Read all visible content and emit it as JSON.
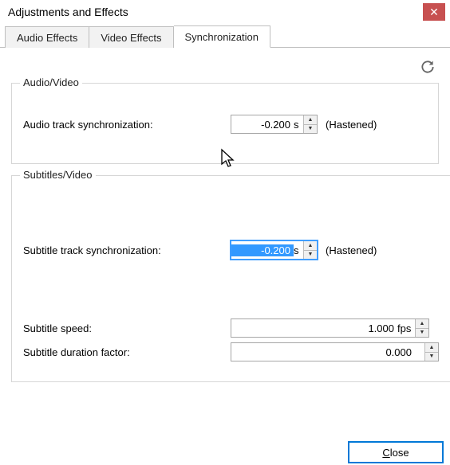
{
  "window": {
    "title": "Adjustments and Effects"
  },
  "tabs": {
    "audio": "Audio Effects",
    "video": "Video Effects",
    "sync": "Synchronization"
  },
  "groups": {
    "av": "Audio/Video",
    "sub": "Subtitles/Video"
  },
  "fields": {
    "audio_sync": {
      "label": "Audio track synchronization:",
      "value": "-0.200",
      "unit": "s",
      "suffix": "(Hastened)"
    },
    "sub_sync": {
      "label": "Subtitle track synchronization:",
      "value": "-0.200",
      "unit": "s",
      "suffix": "(Hastened)"
    },
    "sub_speed": {
      "label": "Subtitle speed:",
      "value": "1.000",
      "unit": "fps"
    },
    "sub_dur": {
      "label": "Subtitle duration factor:",
      "value": "0.000",
      "unit": ""
    }
  },
  "buttons": {
    "close_first": "C",
    "close_rest": "lose"
  }
}
